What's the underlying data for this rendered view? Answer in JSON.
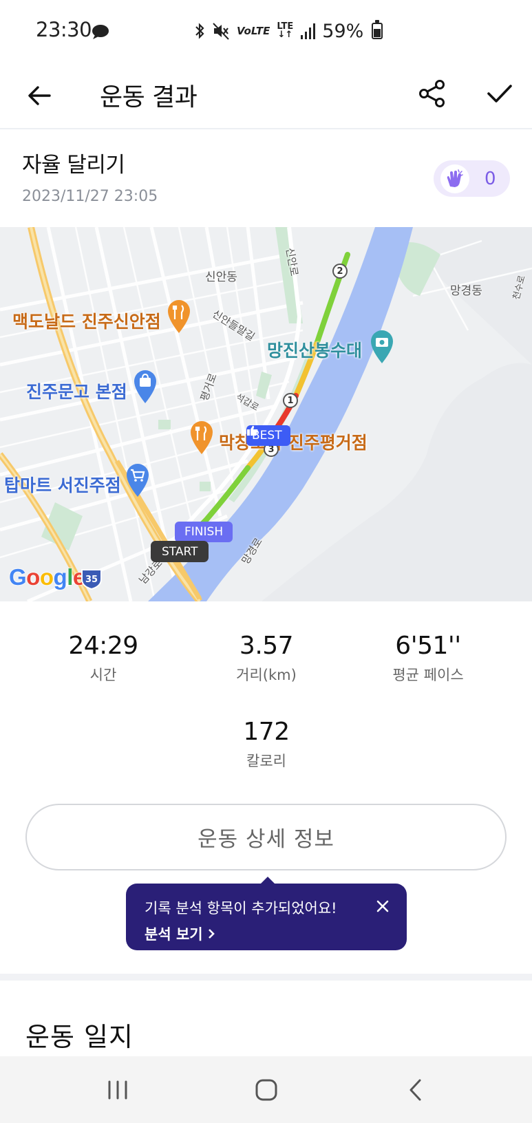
{
  "status_bar": {
    "time": "23:30",
    "network": "LTE",
    "volte": "VoLTE",
    "battery": "59%",
    "battery_level": 0.59,
    "icons": [
      "message-bubble-icon",
      "bluetooth-icon",
      "mute-icon",
      "volte-icon",
      "lte-icon",
      "signal-icon",
      "battery-icon"
    ]
  },
  "header": {
    "title": "운동 결과",
    "back_icon": "arrow-left-icon",
    "share_icon": "share-icon",
    "confirm_icon": "check-icon"
  },
  "activity": {
    "name": "자율 달리기",
    "datetime": "2023/11/27 23:05",
    "claps": "0",
    "clap_icon": "clapping-hands-icon"
  },
  "map": {
    "places": {
      "mcdonalds": "맥도날드 진주신안점",
      "bookstore": "진주문고 본점",
      "restaurant": "막창도둑 진주평거점",
      "mart": "탑마트 서진주점",
      "observatory": "망진산봉수대"
    },
    "areas": {
      "sinan": "신안동",
      "manggyeong": "망경동"
    },
    "roads": {
      "sinanro": "신안로",
      "sinandeulmal": "신안들말길",
      "pyeonggeoro": "평거로",
      "seokgaro": "석갑로",
      "namgangro": "남강로",
      "manggyeongro": "망경로",
      "cheonsuro": "천수로"
    },
    "km_markers": [
      "1",
      "2",
      "3"
    ],
    "best_label": "BEST",
    "finish_label": "FINISH",
    "start_label": "START",
    "attribution": "Google",
    "highway_shield": "35",
    "colors": {
      "river": "#a6bff5",
      "route_fast": "#7fd13b",
      "route_mid": "#f2c230",
      "route_slow": "#e8392b",
      "major_road": "#f7c96a"
    }
  },
  "stats": {
    "time_value": "24:29",
    "time_label": "시간",
    "distance_value": "3.57",
    "distance_label": "거리(km)",
    "pace_value": "6'51''",
    "pace_label": "평균 페이스",
    "calories_value": "172",
    "calories_label": "칼로리"
  },
  "detail_button": "운동 상세 정보",
  "tooltip": {
    "message": "기록 분석 항목이 추가되었어요!",
    "link": "분석 보기",
    "accent": "#2a1f77"
  },
  "journal": {
    "title": "운동 일지"
  },
  "nav": {
    "recents_icon": "recents-icon",
    "home_icon": "home-icon",
    "back_icon": "back-chevron-icon"
  }
}
